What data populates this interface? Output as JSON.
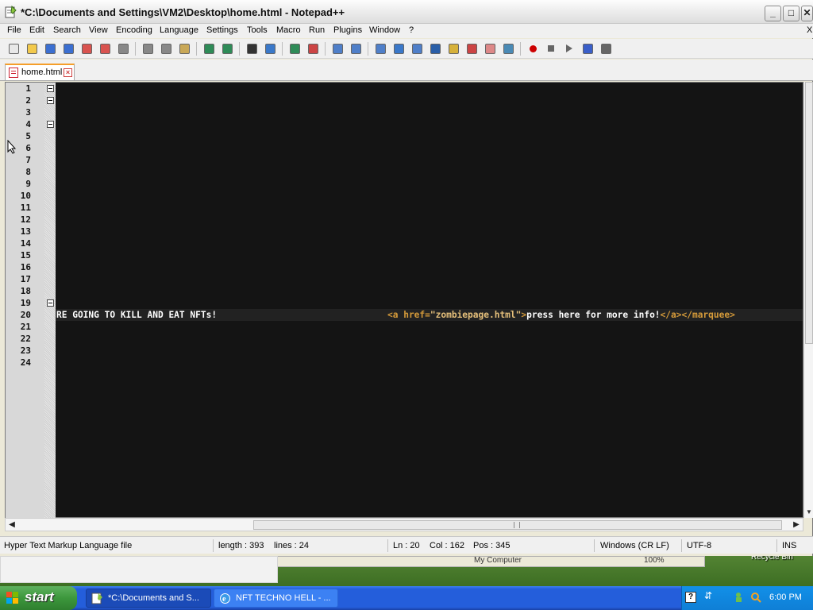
{
  "window": {
    "title": "*C:\\Documents and Settings\\VM2\\Desktop\\home.html - Notepad++",
    "controls": {
      "minimize": "_",
      "maximize": "□",
      "close": "✕"
    }
  },
  "menu": [
    "File",
    "Edit",
    "Search",
    "View",
    "Encoding",
    "Language",
    "Settings",
    "Tools",
    "Macro",
    "Run",
    "Plugins",
    "Window",
    "?"
  ],
  "menu_close": "X",
  "toolbar_icons": [
    "new-file",
    "open-file",
    "save",
    "save-all",
    "close",
    "close-all",
    "print",
    "cut",
    "copy",
    "paste",
    "undo",
    "redo",
    "find",
    "replace",
    "zoom-in",
    "zoom-out",
    "sync-vertical",
    "sync-horizontal",
    "word-wrap",
    "show-all-chars",
    "indent-guide",
    "user-language",
    "doc-map",
    "function-list",
    "folder-workspace",
    "monitor",
    "record-macro",
    "stop-macro",
    "play-macro",
    "run-macro-multiple",
    "save-macro"
  ],
  "tab": {
    "label": "home.html",
    "close": "×"
  },
  "editor": {
    "line_numbers": [
      "1",
      "2",
      "3",
      "4",
      "5",
      "6",
      "7",
      "8",
      "9",
      "10",
      "11",
      "12",
      "13",
      "14",
      "15",
      "16",
      "17",
      "18",
      "19",
      "20",
      "21",
      "22",
      "23",
      "24"
    ],
    "fold_markers_lines": [
      1,
      2,
      4,
      19
    ],
    "current_line": 20,
    "line20": {
      "text1": "RE GOING TO KILL AND EAT NFTs!",
      "tag_open": "<a href=",
      "attr_value": "\"zombiepage.html\"",
      "tag_close": ">",
      "text2": "press here for more info!",
      "end_tags": "</a></marquee>"
    }
  },
  "colors": {
    "editor_bg": "#141414",
    "text": "#ffffff",
    "tag": "#d69b3a",
    "attr_value": "#e6c07b"
  },
  "status": {
    "file_type": "Hyper Text Markup Language file",
    "length": "length : 393",
    "lines": "lines : 24",
    "ln": "Ln : 20",
    "col": "Col : 162",
    "pos": "Pos : 345",
    "eol": "Windows (CR LF)",
    "encoding": "UTF-8",
    "mode": "INS"
  },
  "background_window": {
    "location": "My Computer",
    "zoom": "100%"
  },
  "desktop": {
    "recycle_bin": "Recycle Bin"
  },
  "taskbar": {
    "start": "start",
    "tasks": [
      {
        "label": "*C:\\Documents and S...",
        "active": true
      },
      {
        "label": "NFT TECHNO HELL - ...",
        "active": false
      }
    ],
    "clock": "6:00 PM"
  }
}
